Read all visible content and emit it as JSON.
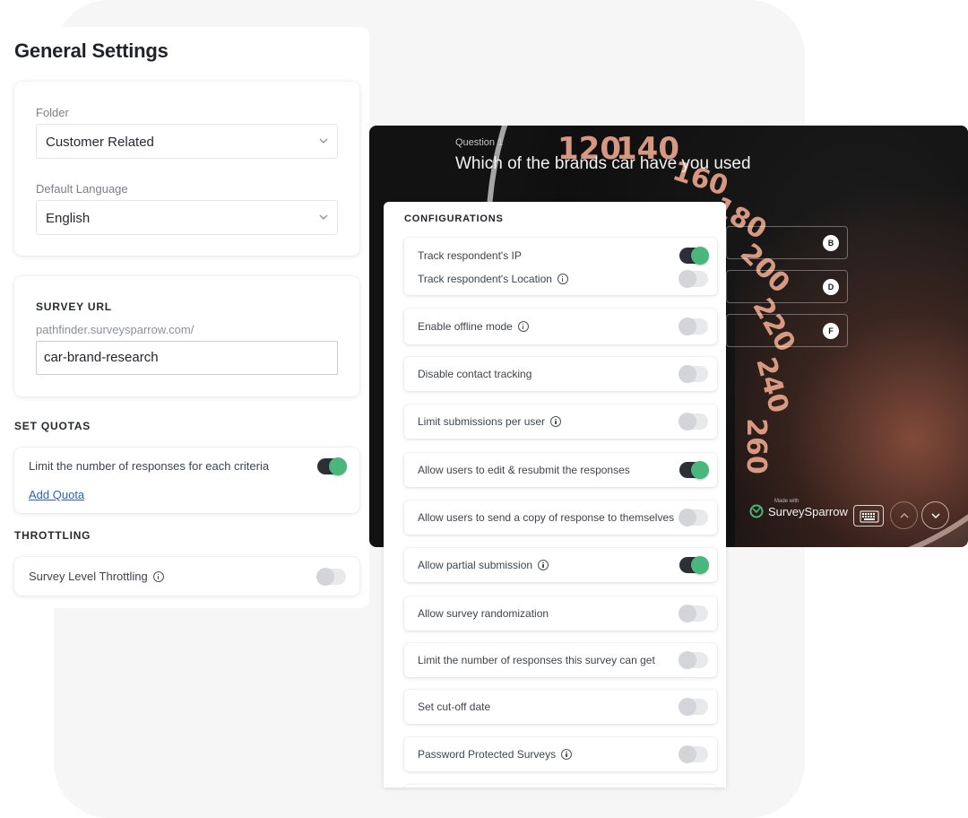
{
  "general": {
    "title": "General Settings",
    "folder_label": "Folder",
    "folder_value": "Customer Related",
    "language_label": "Default Language",
    "language_value": "English",
    "survey_url_title": "SURVEY URL",
    "url_prefix": "pathfinder.surveysparrow.com/",
    "url_slug": "car-brand-research",
    "quotas_title": "SET QUOTAS",
    "quota_text": "Limit the number of responses for each criteria",
    "quota_toggle": true,
    "add_quota": "Add Quota",
    "throttling_title": "THROTTLING",
    "throttling_text": "Survey Level Throttling",
    "throttling_toggle": false
  },
  "preview": {
    "question_number": "Question 1",
    "question_text": "Which of the brands car have you used",
    "option_letters": [
      "B",
      "D",
      "F"
    ],
    "made_with": "Made with",
    "brand": "SurveySparrow",
    "gauge_numbers": [
      "120",
      "140",
      "160",
      "180",
      "200",
      "220",
      "240",
      "260"
    ]
  },
  "config": {
    "title": "CONFIGURATIONS",
    "items": [
      {
        "label": "Track respondent's IP",
        "on": true
      },
      {
        "label": "Track respondent's Location",
        "on": false,
        "info": true
      },
      {
        "label": "Enable offline mode",
        "on": false,
        "info": true
      },
      {
        "label": "Disable contact tracking",
        "on": false
      },
      {
        "label": "Limit submissions per user",
        "on": false,
        "info": true
      },
      {
        "label": "Allow users to edit & resubmit the responses",
        "on": true
      },
      {
        "label": "Allow users to send a copy of response to themselves",
        "on": false
      },
      {
        "label": "Allow partial submission",
        "on": true,
        "info": true
      },
      {
        "label": "Allow survey randomization",
        "on": false
      },
      {
        "label": "Limit the number of responses this survey can get",
        "on": false
      },
      {
        "label": "Set cut-off date",
        "on": false
      },
      {
        "label": "Password Protected Surveys",
        "on": false,
        "info": true
      }
    ]
  },
  "colors": {
    "toggle_on_knob": "#49b67d",
    "toggle_on_track": "#2c3036",
    "link": "#2d5fc4"
  }
}
